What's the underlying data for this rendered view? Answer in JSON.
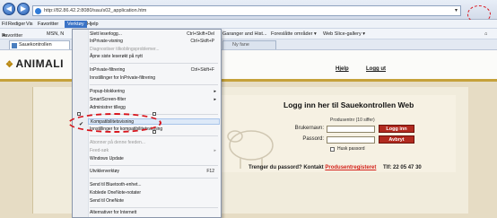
{
  "browser": {
    "url": "http://82.86.42.2:8080/sau/s02_application.htm",
    "menu": [
      "Fil",
      "Rediger",
      "Vis",
      "Favoritter",
      "Verktøy",
      "Hjelp"
    ],
    "active_menu": "Verktøy",
    "favorites_label": "Favoritter",
    "fav_items": [
      "MSN, N",
      "Garanger and Hist...",
      "Foreslåtte områder ▾",
      "Web Slice-gallery ▾"
    ],
    "tabs": [
      "Sauekontrollen",
      "Ny fane"
    ]
  },
  "tools_menu": {
    "items": [
      {
        "label": "Slett leserlogg...",
        "shortcut": "Ctrl+Skift+Del",
        "disabled": false
      },
      {
        "label": "InPrivate-visning",
        "shortcut": "Ctrl+Skift+P",
        "disabled": false
      },
      {
        "label": "Diagnostiser tilkoblingsproblemer...",
        "shortcut": "",
        "disabled": true
      },
      {
        "label": "Åpne siste leserøkt på nytt",
        "shortcut": "",
        "disabled": false
      },
      {
        "label": "InPrivate-filtrering",
        "shortcut": "Ctrl+Skift+F",
        "disabled": false
      },
      {
        "label": "Innstillinger for InPrivate-filtrering",
        "shortcut": "",
        "disabled": false
      },
      {
        "label": "Popup-blokkering",
        "shortcut": "▸",
        "disabled": false
      },
      {
        "label": "SmartScreen-filter",
        "shortcut": "▸",
        "disabled": false
      },
      {
        "label": "Administrer tillegg",
        "shortcut": "",
        "disabled": false
      },
      {
        "label": "Kompatibilitetsvisning",
        "shortcut": "",
        "disabled": false
      },
      {
        "label": "Innstillinger for kompatibilitetsvisning",
        "shortcut": "",
        "disabled": false
      },
      {
        "label": "Abonner på denne feeden...",
        "shortcut": "",
        "disabled": true
      },
      {
        "label": "Feed-søk",
        "shortcut": "▸",
        "disabled": true
      },
      {
        "label": "Windows Update",
        "shortcut": "",
        "disabled": false
      },
      {
        "label": "Utviklerverktøy",
        "shortcut": "F12",
        "disabled": false
      },
      {
        "label": "Send til Bluetooth-enhet...",
        "shortcut": "",
        "disabled": false
      },
      {
        "label": "Koblede OneNote-notater",
        "shortcut": "",
        "disabled": false
      },
      {
        "label": "Send til OneNote",
        "shortcut": "",
        "disabled": false
      },
      {
        "label": "Alternativer for Internett",
        "shortcut": "",
        "disabled": false
      }
    ]
  },
  "page": {
    "logo": "ANIMALI",
    "help_link": "Hjelp",
    "logout_link": "Logg ut",
    "login_title": "Logg inn her til Sauekontrollen Web",
    "producer_label": "Produsentnr (10 siffer)",
    "username_label": "Brukernavn:",
    "password_label": "Passord:",
    "login_button": "Logg inn",
    "cancel_button": "Avbryt",
    "remember_label": "Husk passord",
    "forgot_text": "Trenger du passord? Kontakt",
    "registry_link": "Produsentregisteret",
    "phone": "Tlf: 22 05 47 30"
  },
  "colors": {
    "accent_red": "#b12a1f",
    "gold": "#c5a13a",
    "annotation": "#d8141c"
  }
}
